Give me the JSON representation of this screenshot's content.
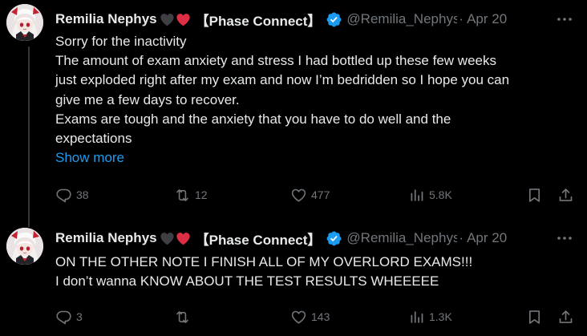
{
  "tweets": [
    {
      "author": {
        "display_name": "Remilia Nephys",
        "hearts": [
          {
            "icon": "black-heart-icon",
            "color": "#3d3f42"
          },
          {
            "icon": "red-heart-icon",
            "color": "#dd2e44"
          }
        ],
        "affiliation": "【Phase Connect】",
        "handle": "@Remilia_Nephys"
      },
      "dot": "·",
      "date": "Apr 20",
      "text_lines": [
        "Sorry for the inactivity",
        "The amount of exam anxiety and stress I had bottled up these few weeks",
        "just exploded right after my exam and now I’m bedridden so I hope you can",
        "give me a few days to recover.",
        "Exams are tough and the anxiety that you have to do well and the",
        "expectations"
      ],
      "show_more": "Show more",
      "actions": {
        "replies": "38",
        "reposts": "12",
        "likes": "477",
        "views": "5.8K"
      }
    },
    {
      "author": {
        "display_name": "Remilia Nephys",
        "hearts": [
          {
            "icon": "black-heart-icon",
            "color": "#3d3f42"
          },
          {
            "icon": "red-heart-icon",
            "color": "#dd2e44"
          }
        ],
        "affiliation": "【Phase Connect】",
        "handle": "@Remilia_Nephys"
      },
      "dot": "·",
      "date": "Apr 20",
      "text_lines": [
        "ON THE OTHER NOTE I FINISH ALL OF MY OVERLORD EXAMS!!!",
        "I don’t wanna KNOW ABOUT THE TEST RESULTS WHEEEEE"
      ],
      "actions": {
        "replies": "3",
        "reposts": "",
        "likes": "143",
        "views": "1.3K"
      }
    }
  ],
  "colors": {
    "background": "#000000",
    "text_primary": "#e7e9ea",
    "text_secondary": "#71767b",
    "link": "#1d9bf0",
    "verified": "#1d9bf0",
    "thread_line": "#333639"
  },
  "icons": {
    "more": "more-dots-icon",
    "verified": "verified-badge-icon",
    "reply": "reply-icon",
    "repost": "repost-icon",
    "like": "like-heart-icon",
    "views": "views-bar-chart-icon",
    "bookmark": "bookmark-icon",
    "share": "share-icon"
  }
}
